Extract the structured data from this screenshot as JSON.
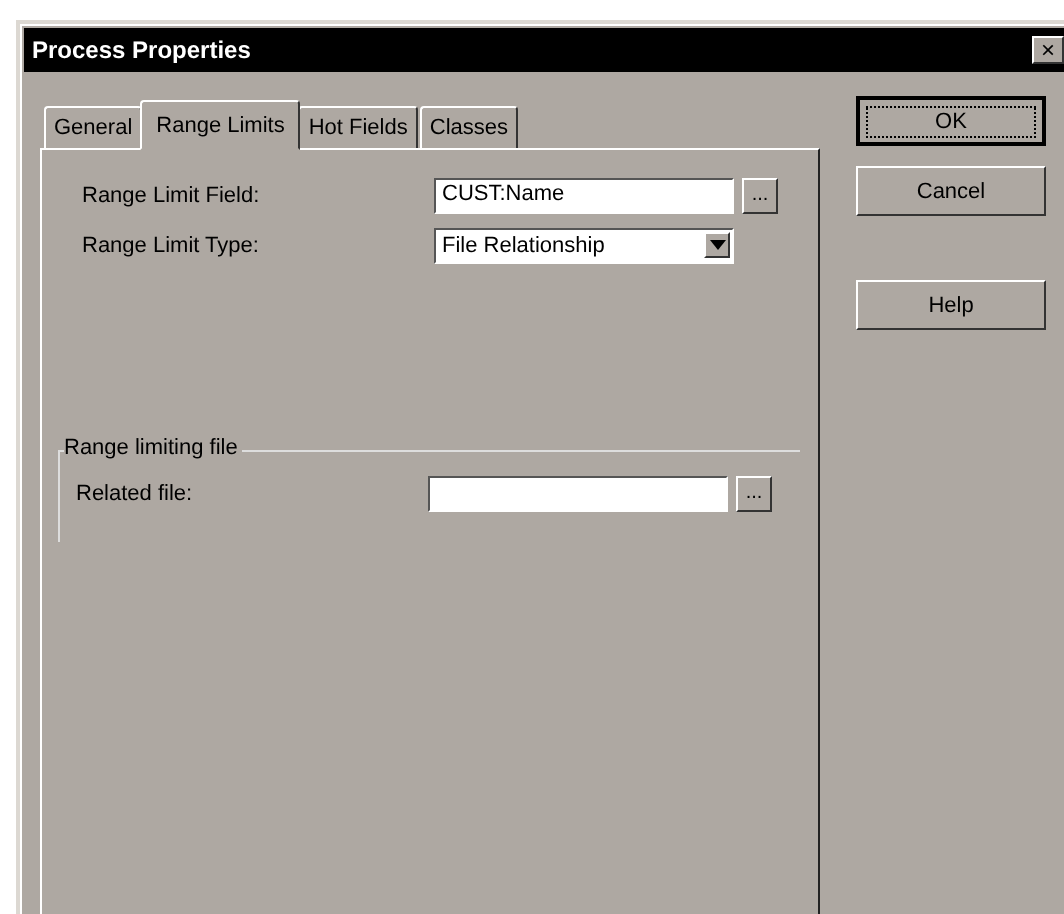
{
  "window": {
    "title": "Process Properties",
    "close": "×"
  },
  "tabs": [
    {
      "label": "General",
      "selected": false
    },
    {
      "label": "Range Limits",
      "selected": true
    },
    {
      "label": "Hot Fields",
      "selected": false
    },
    {
      "label": "Classes",
      "selected": false
    }
  ],
  "fields": [
    {
      "label": "Range Limit Field:",
      "kind": "text",
      "value": "CUST:Name",
      "button": "..."
    },
    {
      "label": "Range Limit Type:",
      "kind": "dropdown",
      "value": "File Relationship"
    }
  ],
  "group": {
    "title": "Range limiting file",
    "fields": [
      {
        "label": "Related file:",
        "kind": "text",
        "button": "..."
      }
    ]
  },
  "buttons": [
    {
      "label": "OK",
      "default": true
    },
    {
      "label": "Cancel",
      "default": false
    },
    {
      "label": "Help",
      "default": false
    }
  ]
}
